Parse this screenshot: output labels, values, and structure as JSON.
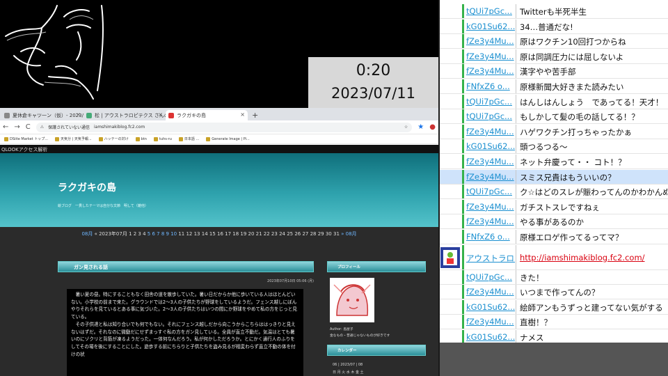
{
  "overlay": {
    "time": "0:20",
    "date": "2023/07/11"
  },
  "browser": {
    "tabs": [
      {
        "label": "夏休倉キャツ一ン（仮）- 2023/"
      },
      {
        "label": "松 | アウストラロピテクス さんの「らくが"
      },
      {
        "label": "ラクガキの島"
      }
    ],
    "new_tab": "+",
    "nav": {
      "back": "←",
      "forward": "→",
      "reload": "C"
    },
    "address": {
      "warning": "保護されていない通信",
      "url": "iamshimakiblog.fc2.com"
    },
    "bookmarks": [
      "DSiite Market トップ...",
      "天気分 | 天気予報...",
      "ハッテーの対け",
      "btn",
      "tuhs-ru",
      "日本語 ...",
      "Generate Image | Pi..."
    ]
  },
  "page": {
    "qlook": "QLOOKアクセス解析",
    "blog_title": "ラクガキの島",
    "blog_sub": "絵ブログ　一貫したテーマは自分な文節　明して（雑他）",
    "calendar": {
      "prev": "08月",
      "month_label": "« 2023年07月",
      "days_plain_a": "1 2 3 4",
      "days_linked": "5 6 7 8 9 10",
      "days_plain_b": "11 12 13 14 15 16 17 18 19 20 21 22 23 24 25 26 27 28 29 30 31",
      "next": "» 08月"
    },
    "post": {
      "title": "ガン見される話",
      "date": "2023年07月10日 05:06 (月)",
      "paragraphs": [
        "暑い夏の昼。特にすることもなく田舎の道を散歩していた。暑い日だからか他に歩いている人はほとんどいない。小学校の前まで来た。グラウンドでは2〜3人の子供たちが野球をしているようだ。フェンス越しにぼんやりそれらを見ているとある事に気づいた。2〜3人の子供たちはいつの間にか野球をやめて私の方をじっと見ている。",
        "その子供達と私は知り合いでも何でもない。それにフェンス越しだから向こうからこちらははっきりと見えないはずだ。それなのに微動だにせずまっすぐ私の方をガン見している。全員が直立不動だ。気温はとても暑いのにゾクリと背筋が凍るようだった。一体何なんだろう。私が何かしただろうか。とにかく通行人のふりをしてその場を後にすることにした。遊歩する前にちらりと子供たちを盗み見るが相変わらず直立不動の体を付けの状"
      ]
    },
    "profile": {
      "heading": "プロフィール",
      "author": "Author: 島屋子",
      "desc": "金なもの・普通じゃないものが好きです"
    },
    "calendar_side": {
      "heading": "カレンダー",
      "line1": "06 | 2023/07 | 08",
      "line2": "日 月 火 水 木 金 土"
    }
  },
  "chat": {
    "rows": [
      {
        "uid": "tQUi7pGc...",
        "msg": "Twitterも半死半生"
      },
      {
        "uid": "kG01Su62...",
        "msg": "34…普通だな!"
      },
      {
        "uid": "fZe3y4Mu...",
        "msg": "原はワクチン10回打つからね"
      },
      {
        "uid": "fZe3y4Mu...",
        "msg": "原は同調圧力には屈しないよ"
      },
      {
        "uid": "fZe3y4Mu...",
        "msg": "漢字やや苦手部"
      },
      {
        "uid": "FNfxZ6 o...",
        "msg": "原様新聞大好きまた読みたい"
      },
      {
        "uid": "tQUi7pGc...",
        "msg": "はんしはんしょう　であってる！天才！"
      },
      {
        "uid": "tQUi7pGc...",
        "msg": "もしかして髪の毛の話してる！？"
      },
      {
        "uid": "fZe3y4Mu...",
        "msg": "ハゲワクチン打っちゃったかぁ"
      },
      {
        "uid": "kG01Su62...",
        "msg": "頭つるつる〜"
      },
      {
        "uid": "fZe3y4Mu...",
        "msg": "ネット弁慶って・・ コト！？"
      },
      {
        "uid": "fZe3y4Mu...",
        "msg": "スミス兄貴はもういいの？"
      },
      {
        "uid": "tQUi7pGc...",
        "msg": "ク☆はどのスレが賑わってんのかわかんぬぇ"
      },
      {
        "uid": "fZe3y4Mu...",
        "msg": "ガチストスレですねぇ"
      },
      {
        "uid": "fZe3y4Mu...",
        "msg": "やる事があるのか"
      },
      {
        "uid": "FNfxZ6 o...",
        "msg": "原様エロゲ作ってるってマ？"
      },
      {
        "uid": "アウストラロ...",
        "msg": "http://iamshimakiblog.fc2.com/"
      },
      {
        "uid": "tQUi7pGc...",
        "msg": "きた！"
      },
      {
        "uid": "fZe3y4Mu...",
        "msg": "いつまで作ってんの？"
      },
      {
        "uid": "kG01Su62...",
        "msg": "絵師アンもうずっと建ってない気がする"
      },
      {
        "uid": "fZe3y4Mu...",
        "msg": "直樹！？"
      },
      {
        "uid": "kG01Su62...",
        "msg": "ナメス"
      }
    ]
  }
}
